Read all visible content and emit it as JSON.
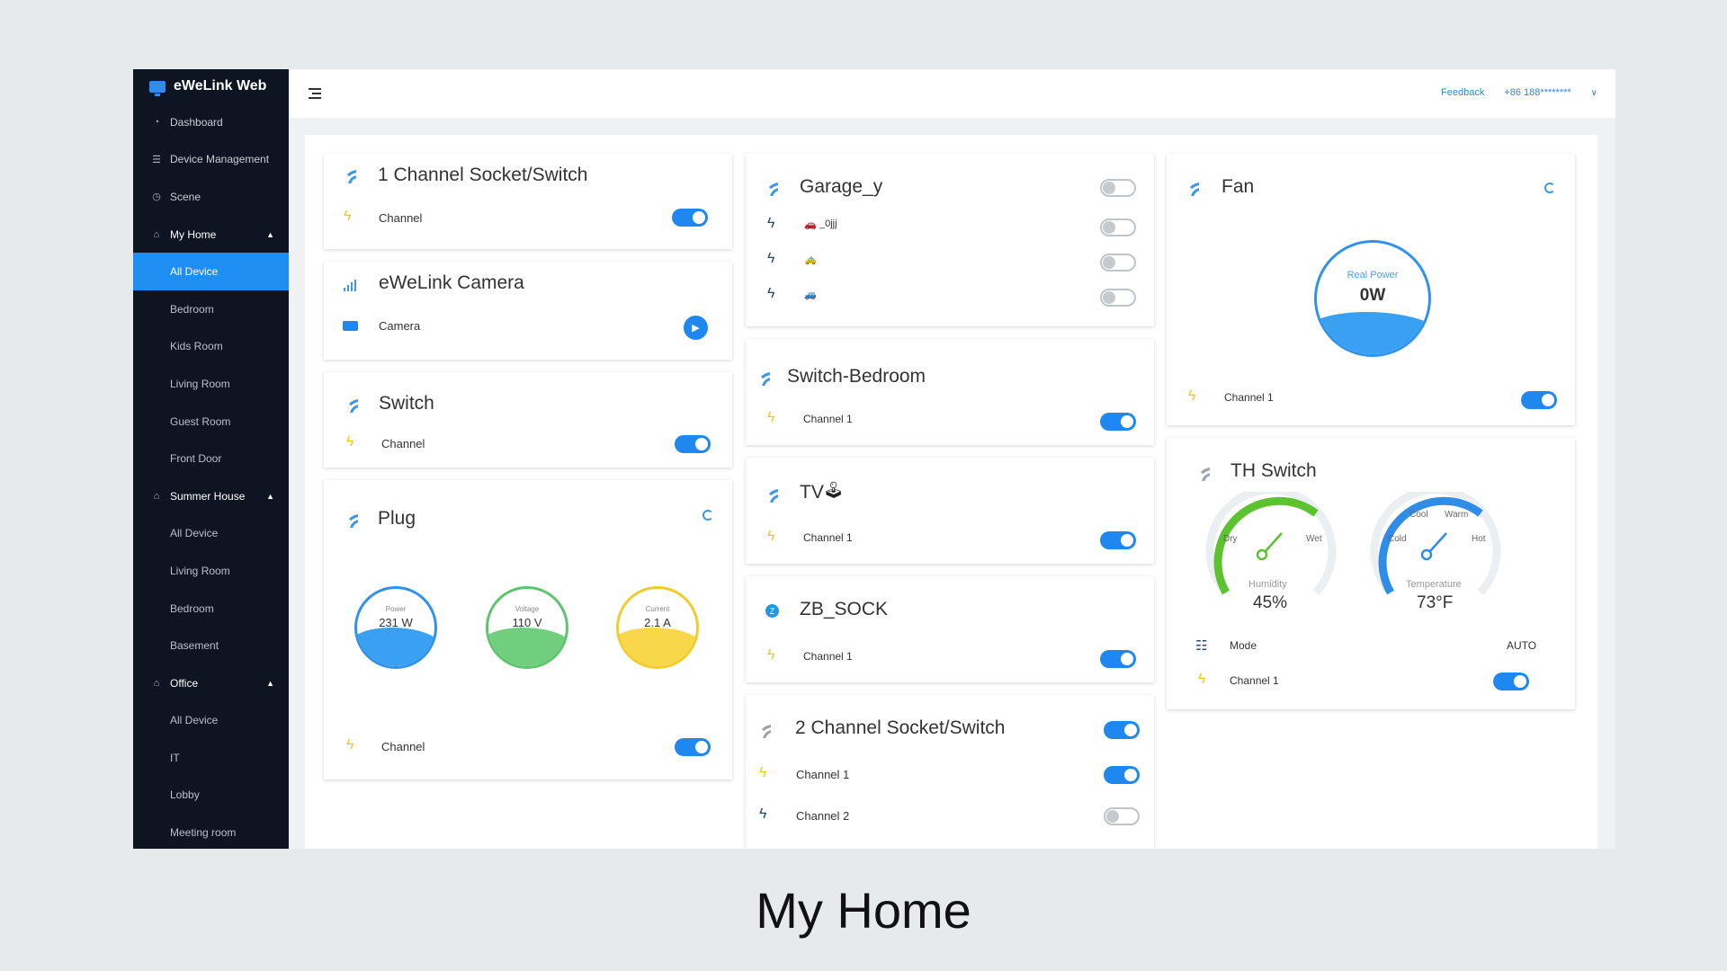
{
  "app": {
    "title": "eWeLink Web"
  },
  "sidebar": {
    "items": [
      {
        "label": "Dashboard",
        "icon": "dashboard-icon"
      },
      {
        "label": "Device Management",
        "icon": "list-icon"
      },
      {
        "label": "Scene",
        "icon": "clock-icon"
      }
    ],
    "groups": [
      {
        "label": "My Home",
        "rooms": [
          "All Device",
          "Bedroom",
          "Kids Room",
          "Living Room",
          "Guest Room",
          "Front Door"
        ]
      },
      {
        "label": "Summer House",
        "rooms": [
          "All Device",
          "Living Room",
          "Bedroom",
          "Basement"
        ]
      },
      {
        "label": "Office",
        "rooms": [
          "All Device",
          "IT",
          "Lobby",
          "Meeting room"
        ]
      }
    ]
  },
  "header": {
    "feedback": "Feedback",
    "account": "+86 188********"
  },
  "cards": {
    "socket1": {
      "title": "1 Channel Socket/Switch",
      "channel": "Channel",
      "on": true
    },
    "camera": {
      "title": "eWeLink Camera",
      "channel": "Camera"
    },
    "switch": {
      "title": "Switch",
      "channel": "Channel",
      "on": true
    },
    "plug": {
      "title": "Plug",
      "channel": "Channel",
      "on": true,
      "gauges": [
        {
          "label": "Power",
          "value": "231 W",
          "level": 0.45,
          "color": "#2f93ee"
        },
        {
          "label": "Voltage",
          "value": "110 V",
          "level": 0.45,
          "color": "#5fc46e"
        },
        {
          "label": "Current",
          "value": "2.1 A",
          "level": 0.45,
          "color": "#f4cc2a"
        }
      ]
    },
    "garage": {
      "title": "Garage_y",
      "sub1": "_0jjj"
    },
    "bedroom": {
      "title": "Switch-Bedroom",
      "channel": "Channel 1",
      "on": true
    },
    "tv": {
      "title": "TV",
      "channel": "Channel 1",
      "on": true
    },
    "zb": {
      "title": "ZB_SOCK",
      "channel": "Channel 1",
      "on": true
    },
    "socket2": {
      "title": "2 Channel Socket/Switch",
      "ch1": "Channel 1",
      "ch2": "Channel 2"
    },
    "fan": {
      "title": "Fan",
      "gauge_label": "Real Power",
      "gauge_value": "0W",
      "channel": "Channel 1",
      "on": true
    },
    "th": {
      "title": "TH Switch",
      "humidity": {
        "label": "Humidity",
        "value": "45%",
        "left": "Dry",
        "right": "Wet"
      },
      "temperature": {
        "label": "Temperature",
        "value": "73°F",
        "left": "Cold",
        "right": "Hot",
        "topleft": "Cool",
        "topright": "Warm"
      },
      "mode_label": "Mode",
      "mode_value": "AUTO",
      "channel": "Channel 1"
    }
  },
  "caption": "My Home"
}
